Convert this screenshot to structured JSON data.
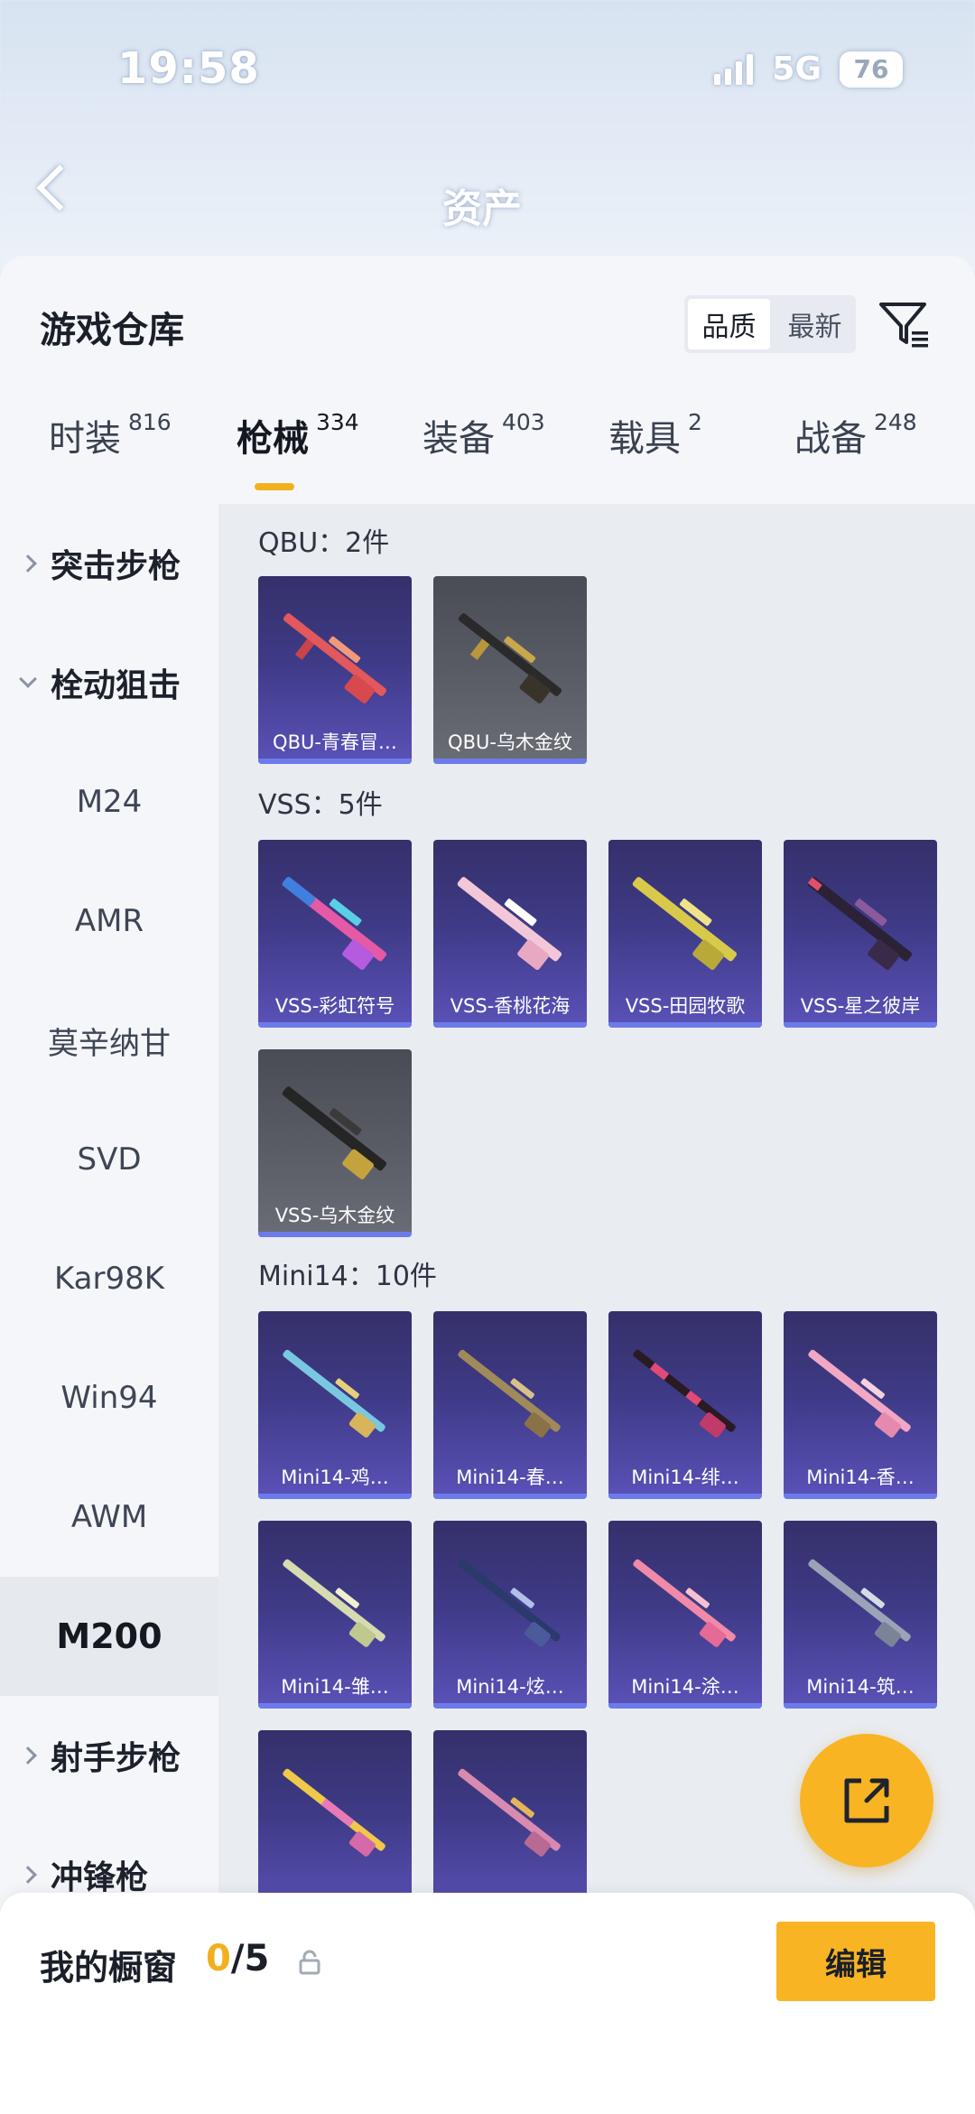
{
  "status_bar": {
    "time": "19:58",
    "network": "5G",
    "battery": "76"
  },
  "header": {
    "title": "资产"
  },
  "sheet": {
    "title": "游戏仓库",
    "sort_options": [
      "品质",
      "最新"
    ],
    "sort_selected": "品质"
  },
  "tabs": [
    {
      "label": "时装",
      "count": "816"
    },
    {
      "label": "枪械",
      "count": "334",
      "active": true
    },
    {
      "label": "装备",
      "count": "403"
    },
    {
      "label": "载具",
      "count": "2"
    },
    {
      "label": "战备",
      "count": "248"
    }
  ],
  "categories": {
    "assault": "突击步枪",
    "bolt": "栓动狙击",
    "m24": "M24",
    "amr": "AMR",
    "mosin": "莫辛纳甘",
    "svd": "SVD",
    "kar98k": "Kar98K",
    "win94": "Win94",
    "awm": "AWM",
    "m200": "M200",
    "dmr": "射手步枪",
    "smg": "冲锋枪"
  },
  "sections": {
    "qbu": {
      "title": "QBU：2件",
      "items": [
        "QBU-青春冒…",
        "QBU-乌木金纹"
      ]
    },
    "vss": {
      "title": "VSS：5件",
      "items": [
        "VSS-彩虹符号",
        "VSS-香桃花海",
        "VSS-田园牧歌",
        "VSS-星之彼岸",
        "VSS-乌木金纹"
      ]
    },
    "mini14": {
      "title": "Mini14：10件",
      "items": [
        "Mini14-鸡…",
        "Mini14-春…",
        "Mini14-绯…",
        "Mini14-香…",
        "Mini14-雏…",
        "Mini14-炫…",
        "Mini14-涂…",
        "Mini14-筑…",
        "",
        ""
      ]
    }
  },
  "bottom": {
    "label": "我的橱窗",
    "count_current": "0",
    "count_separator": "/5",
    "edit_label": "编辑"
  }
}
